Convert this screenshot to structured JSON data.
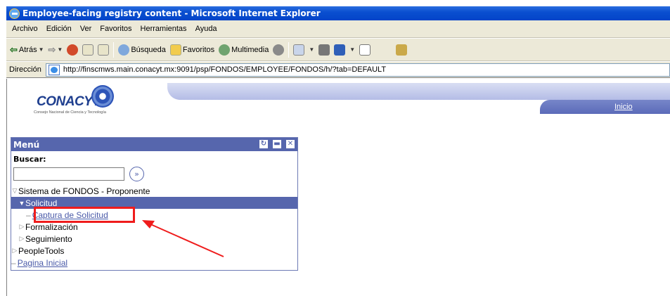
{
  "window": {
    "title": "Employee-facing registry content - Microsoft Internet Explorer"
  },
  "menubar": {
    "items": [
      "Archivo",
      "Edición",
      "Ver",
      "Favoritos",
      "Herramientas",
      "Ayuda"
    ]
  },
  "toolbar": {
    "back_label": "Atrás",
    "search_label": "Búsqueda",
    "favorites_label": "Favoritos",
    "media_label": "Multimedia"
  },
  "address": {
    "label": "Dirección",
    "url": "http://finscmws.main.conacyt.mx:9091/psp/FONDOS/EMPLOYEE/FONDOS/h/?tab=DEFAULT"
  },
  "header": {
    "logo_text": "CONACYT",
    "logo_subtitle": "Consejo Nacional de Ciencia y Tecnología",
    "home_link": "Inicio"
  },
  "menu": {
    "title": "Menú",
    "search_label": "Buscar:",
    "search_value": "",
    "items": [
      {
        "label": "Sistema de FONDOS - Proponente"
      },
      {
        "label": "Solicitud"
      },
      {
        "label": "Captura de Solicitud"
      },
      {
        "label": "Formalización"
      },
      {
        "label": "Seguimiento"
      },
      {
        "label": "PeopleTools"
      },
      {
        "label": "Pagina Inicial"
      }
    ]
  },
  "colors": {
    "titlebar": "#0a4fd0",
    "pagelet_header": "#5666ad",
    "highlight_box": "#ef1c1c",
    "link": "#4a5aa8"
  }
}
